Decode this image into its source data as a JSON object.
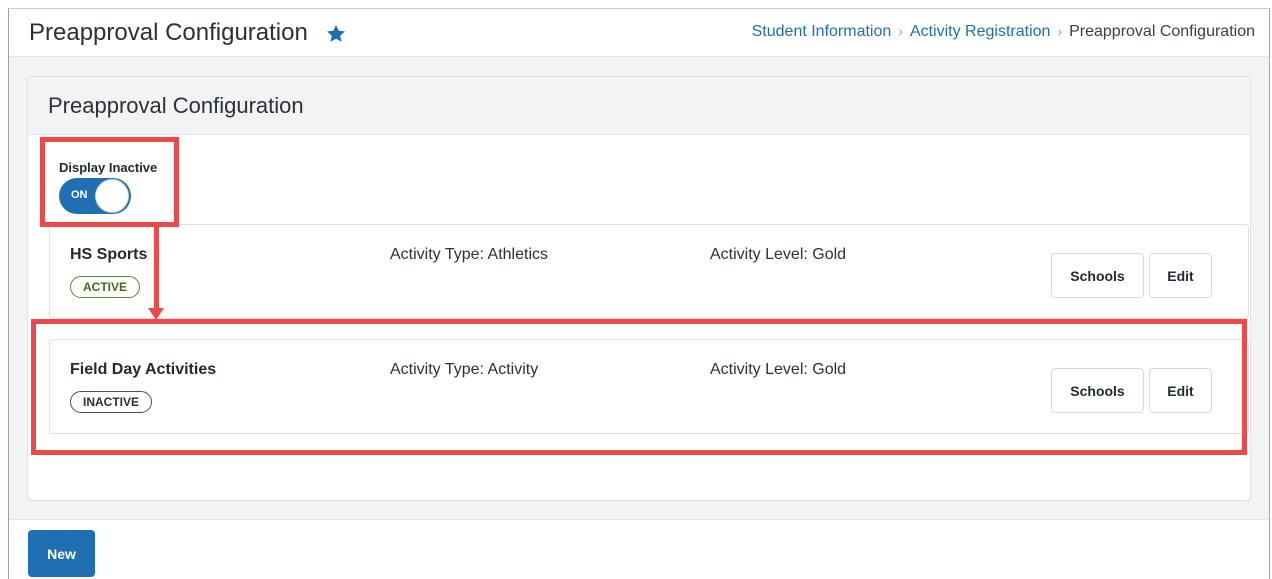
{
  "header": {
    "title": "Preapproval Configuration",
    "star_icon": "star-icon",
    "breadcrumb": [
      {
        "label": "Student Information",
        "link": true
      },
      {
        "label": "Activity Registration",
        "link": true
      },
      {
        "label": "Preapproval Configuration",
        "link": false
      }
    ],
    "separator": "›"
  },
  "card": {
    "title": "Preapproval Configuration",
    "display_inactive": {
      "label": "Display Inactive",
      "state_text": "ON",
      "on": true
    }
  },
  "items": [
    {
      "name": "HS Sports",
      "status": "ACTIVE",
      "activity_type": "Activity Type: Athletics",
      "activity_level": "Activity Level: Gold",
      "schools_label": "Schools",
      "edit_label": "Edit"
    },
    {
      "name": "Field Day Activities",
      "status": "INACTIVE",
      "activity_type": "Activity Type: Activity",
      "activity_level": "Activity Level: Gold",
      "schools_label": "Schools",
      "edit_label": "Edit"
    }
  ],
  "footer": {
    "new_label": "New"
  },
  "colors": {
    "accent": "#1f6fb2",
    "annotation": "#ec4a4a",
    "active_badge": "#5a8a2a"
  }
}
